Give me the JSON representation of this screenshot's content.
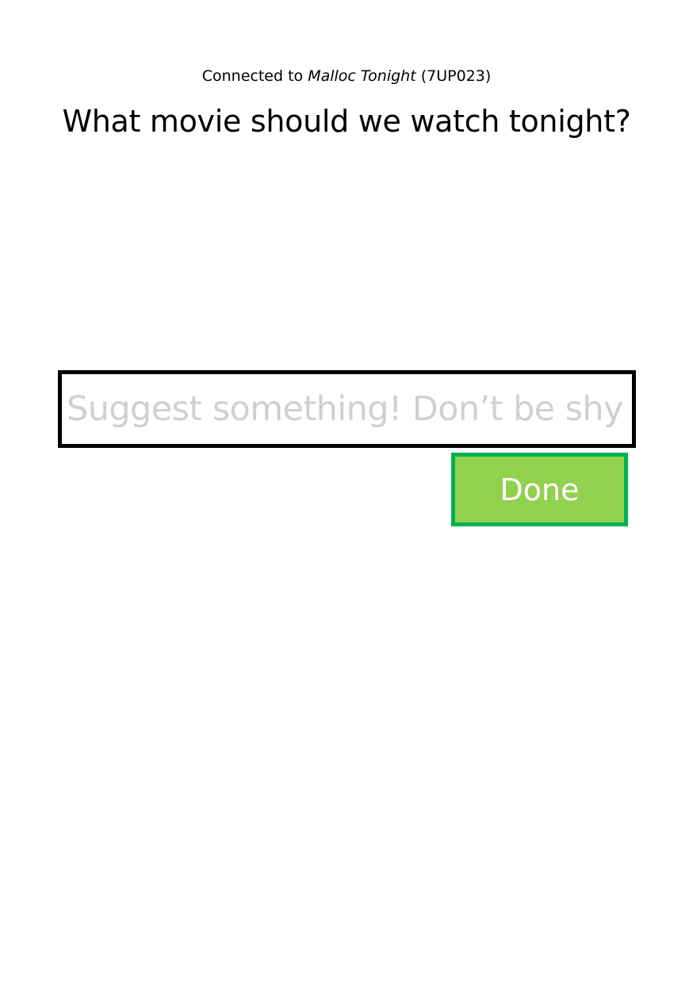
{
  "header": {
    "connection_prefix": "Connected to ",
    "session_name": "Malloc Tonight",
    "session_code": "(7UP023)"
  },
  "question": {
    "text": "What movie should we watch tonight?"
  },
  "suggestion": {
    "value": "",
    "placeholder": "Suggest something! Don’t be shy!"
  },
  "actions": {
    "done_label": "Done"
  },
  "colors": {
    "done_fill": "#92d050",
    "done_border": "#00b050",
    "input_border": "#000000",
    "placeholder_text": "#d0d0d0"
  }
}
